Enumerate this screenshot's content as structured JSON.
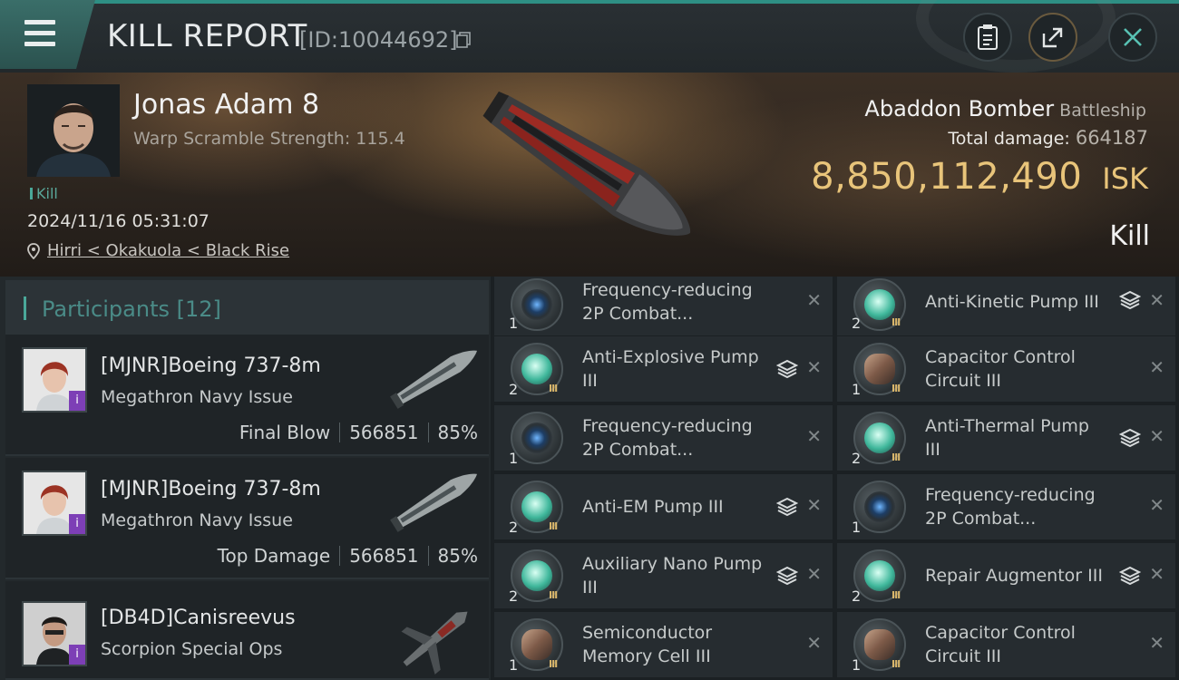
{
  "header": {
    "title": "KILL REPORT",
    "report_id": "[ID:10044692]"
  },
  "victim": {
    "name": "Jonas Adam 8",
    "warp_scramble": "Warp Scramble Strength: 115.4",
    "tag": "Kill",
    "time": "2024/11/16 05:31:07",
    "location": "Hirri < Okakuola < Black Rise",
    "ship_name": "Abaddon Bomber",
    "ship_class": "Battleship",
    "total_damage_label": "Total damage:",
    "total_damage": "664187",
    "isk_value": "8,850,112,490",
    "isk_unit": "ISK",
    "outcome": "Kill"
  },
  "participants": {
    "title": "Participants [12]",
    "items": [
      {
        "name": "[MJNR]Boeing 737-8m",
        "ship": "Megathron Navy Issue",
        "role": "Final Blow",
        "damage": "566851",
        "percent": "85%"
      },
      {
        "name": "[MJNR]Boeing 737-8m",
        "ship": "Megathron Navy Issue",
        "role": "Top Damage",
        "damage": "566851",
        "percent": "85%"
      },
      {
        "name": "[DB4D]Canisreevus",
        "ship": "Scorpion Special Ops"
      }
    ]
  },
  "modules": [
    {
      "qty": "1",
      "name": "Frequency-reducing 2P Combat...",
      "icon": "scram-icon",
      "stack": false
    },
    {
      "qty": "2",
      "name": "Anti-Kinetic Pump III",
      "icon": "pump-icon",
      "stack": true
    },
    {
      "qty": "2",
      "name": "Anti-Explosive Pump III",
      "icon": "pump-icon",
      "stack": true
    },
    {
      "qty": "1",
      "name": "Capacitor Control Circuit III",
      "icon": "capacitor-icon",
      "stack": false
    },
    {
      "qty": "1",
      "name": "Frequency-reducing 2P Combat...",
      "icon": "scram-icon",
      "stack": false
    },
    {
      "qty": "2",
      "name": "Anti-Thermal Pump III",
      "icon": "pump-icon",
      "stack": true
    },
    {
      "qty": "2",
      "name": "Anti-EM Pump III",
      "icon": "pump-icon",
      "stack": true
    },
    {
      "qty": "1",
      "name": "Frequency-reducing 2P Combat...",
      "icon": "scram-icon",
      "stack": false
    },
    {
      "qty": "2",
      "name": "Auxiliary Nano Pump III",
      "icon": "pump-icon",
      "stack": true
    },
    {
      "qty": "2",
      "name": "Repair Augmentor III",
      "icon": "pump-icon",
      "stack": true
    },
    {
      "qty": "1",
      "name": "Semiconductor Memory Cell III",
      "icon": "capacitor-icon",
      "stack": false
    },
    {
      "qty": "1",
      "name": "Capacitor Control Circuit III",
      "icon": "capacitor-icon",
      "stack": false
    }
  ],
  "colors": {
    "accent": "#4aa899",
    "isk": "#e8c47a",
    "badge": "#7d3fb6"
  }
}
